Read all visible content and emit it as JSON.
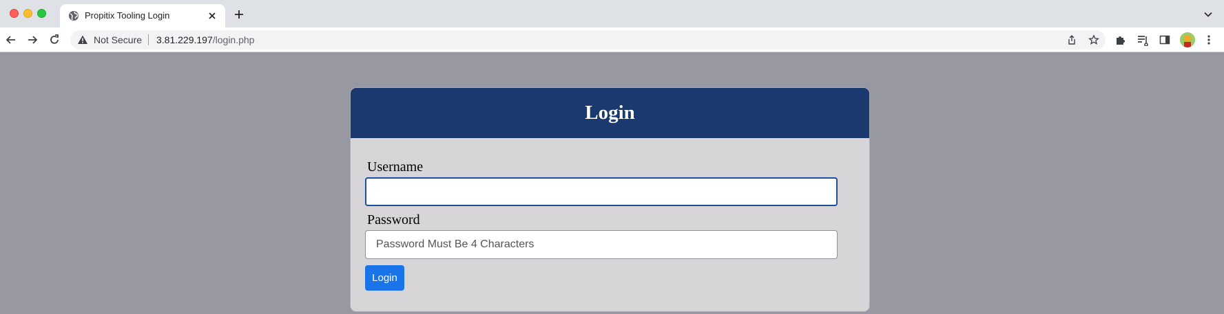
{
  "browser": {
    "tab": {
      "title": "Propitix Tooling Login",
      "icon": "globe-icon"
    },
    "address_bar": {
      "security_label": "Not Secure",
      "url_host": "3.81.229.197",
      "url_path": "/login.php"
    }
  },
  "login_form": {
    "title": "Login",
    "username": {
      "label": "Username",
      "value": "",
      "placeholder": ""
    },
    "password": {
      "label": "Password",
      "value": "",
      "placeholder": "Password Must Be 4 Characters"
    },
    "submit_label": "Login"
  },
  "colors": {
    "page_background": "#9898a2",
    "header_background": "#1a396e",
    "card_background": "#d7d5d7",
    "button_background": "#1a73e8"
  }
}
